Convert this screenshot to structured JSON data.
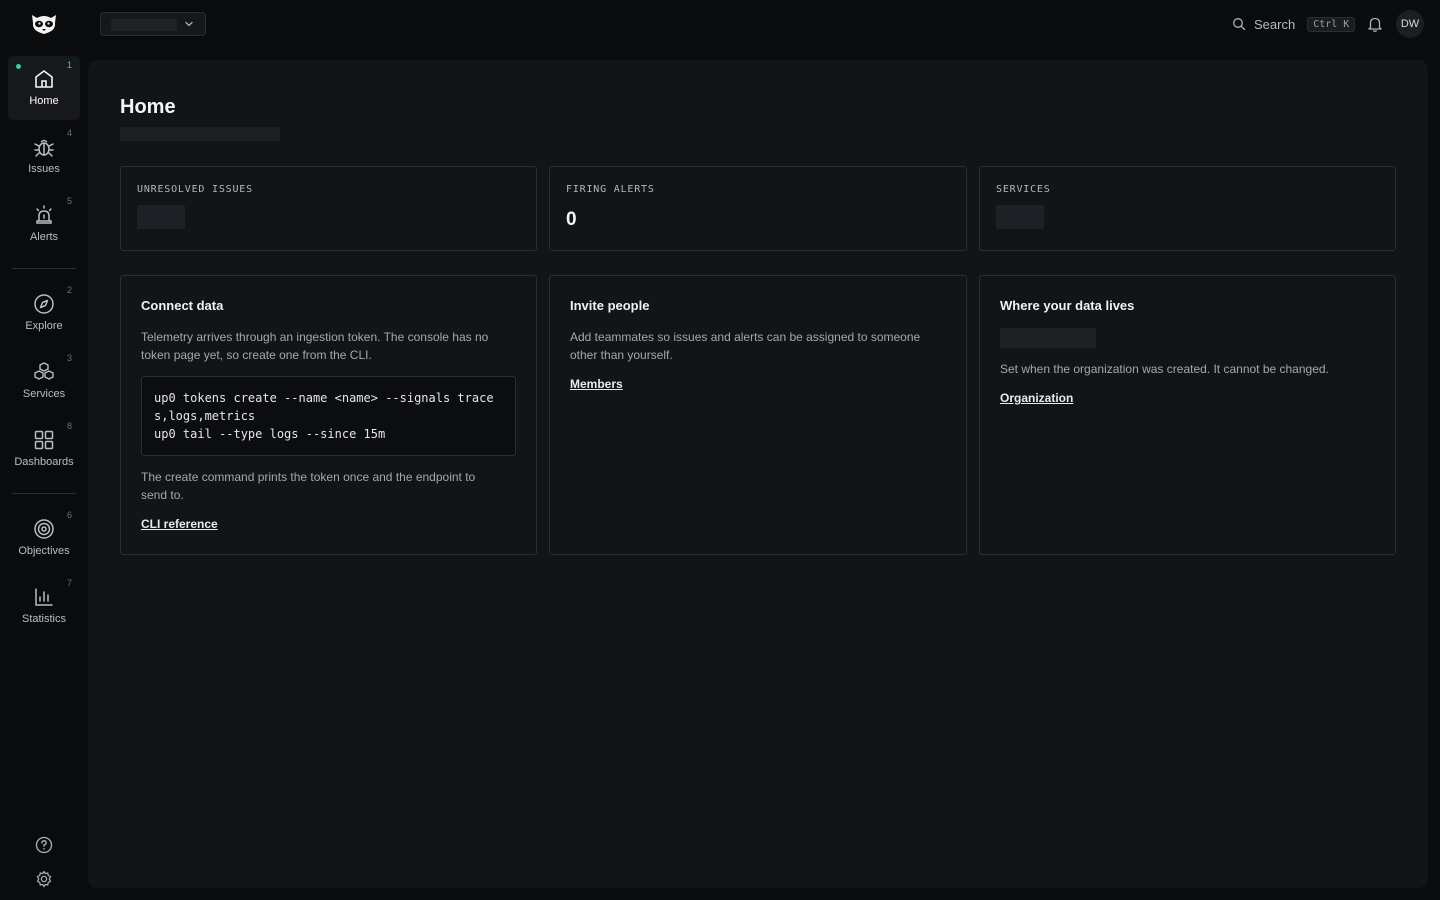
{
  "topbar": {
    "search_label": "Search",
    "search_shortcut": "Ctrl K",
    "avatar_initials": "DW"
  },
  "sidebar": {
    "items": [
      {
        "label": "Home",
        "shortcut": "1",
        "icon": "home-icon",
        "active": true
      },
      {
        "label": "Issues",
        "shortcut": "4",
        "icon": "bug-icon"
      },
      {
        "label": "Alerts",
        "shortcut": "5",
        "icon": "siren-icon"
      },
      {
        "label": "Explore",
        "shortcut": "2",
        "icon": "compass-icon"
      },
      {
        "label": "Services",
        "shortcut": "3",
        "icon": "boxes-icon"
      },
      {
        "label": "Dashboards",
        "shortcut": "8",
        "icon": "grid-icon"
      },
      {
        "label": "Objectives",
        "shortcut": "6",
        "icon": "target-icon"
      },
      {
        "label": "Statistics",
        "shortcut": "7",
        "icon": "bar-chart-icon"
      }
    ],
    "bottom_icons": [
      "help-icon",
      "settings-icon"
    ]
  },
  "main": {
    "title": "Home",
    "stats": [
      {
        "label": "UNRESOLVED ISSUES",
        "value": null,
        "loading": true
      },
      {
        "label": "FIRING ALERTS",
        "value": "0",
        "loading": false
      },
      {
        "label": "SERVICES",
        "value": null,
        "loading": true
      }
    ],
    "connect": {
      "title": "Connect data",
      "desc": "Telemetry arrives through an ingestion token. The console has no token page yet, so create one from the CLI.",
      "code": "up0 tokens create --name <name> --signals trace\ns,logs,metrics\nup0 tail --type logs --since 15m",
      "note": "The create command prints the token once and the endpoint to send to.",
      "link": "CLI reference"
    },
    "invite": {
      "title": "Invite people",
      "desc": "Add teammates so issues and alerts can be assigned to someone other than yourself.",
      "link": "Members"
    },
    "region": {
      "title": "Where your data lives",
      "desc": "Set when the organization was created. It cannot be changed.",
      "link": "Organization"
    }
  },
  "colors": {
    "background": "#0a0b0d",
    "panel": "#121418",
    "border": "#2a2d33",
    "accent_green": "#34d399"
  }
}
